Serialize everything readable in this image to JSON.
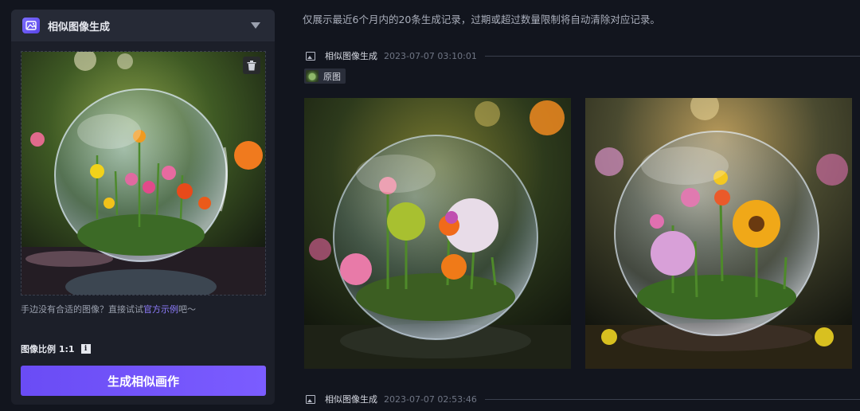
{
  "left_panel": {
    "title": "相似图像生成",
    "hint_prefix": "手边没有合适的图像？直接试试",
    "hint_link": "官方示例",
    "hint_suffix": "吧～",
    "ratio_label": "图像比例 1:1",
    "info_glyph": "i",
    "generate_label": "生成相似画作"
  },
  "notice": "仅展示最近6个月内的20条生成记录，过期或超过数量限制将自动清除对应记录。",
  "records": [
    {
      "title": "相似图像生成",
      "time": "2023-07-07 03:10:01",
      "origin_label": "原图"
    },
    {
      "title": "相似图像生成",
      "time": "2023-07-07 02:53:46"
    }
  ],
  "icons": [
    "image-logo-icon",
    "chevron-down-icon",
    "trash-icon",
    "info-icon",
    "image-icon"
  ],
  "colors": {
    "accent": "#7b5cff",
    "background": "#12151e",
    "panel": "#1c1f29"
  }
}
